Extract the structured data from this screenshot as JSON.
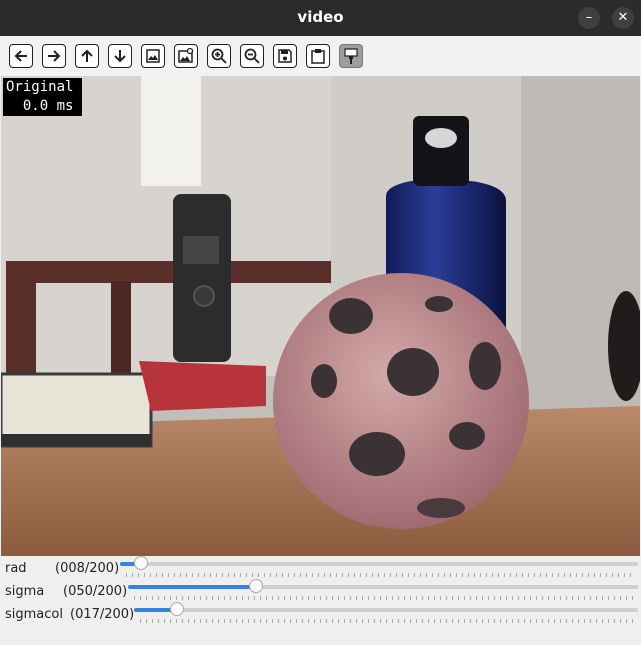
{
  "window": {
    "title": "video",
    "minimize_icon": "minimize-icon",
    "close_icon": "close-icon"
  },
  "toolbar": {
    "buttons": [
      {
        "name": "pan-left-button",
        "icon": "arrow-left-icon"
      },
      {
        "name": "pan-right-button",
        "icon": "arrow-right-icon"
      },
      {
        "name": "pan-up-button",
        "icon": "arrow-up-icon"
      },
      {
        "name": "pan-down-button",
        "icon": "arrow-down-icon"
      },
      {
        "name": "zoom-fit-button",
        "icon": "image-icon"
      },
      {
        "name": "zoom-original-button",
        "icon": "image-search-icon"
      },
      {
        "name": "zoom-in-button",
        "icon": "zoom-in-icon"
      },
      {
        "name": "zoom-out-button",
        "icon": "zoom-out-icon"
      },
      {
        "name": "save-button",
        "icon": "save-icon"
      },
      {
        "name": "copy-button",
        "icon": "clipboard-icon"
      },
      {
        "name": "properties-button",
        "icon": "paint-brush-icon"
      }
    ]
  },
  "overlay": {
    "line1": "Original",
    "line2": "  0.0 ms"
  },
  "sliders": [
    {
      "label": "rad",
      "value_text": "(008/200)",
      "value": 8,
      "max": 200
    },
    {
      "label": "sigma",
      "value_text": "(050/200)",
      "value": 50,
      "max": 200
    },
    {
      "label": "sigmacol",
      "value_text": "(017/200)",
      "value": 17,
      "max": 200
    }
  ]
}
